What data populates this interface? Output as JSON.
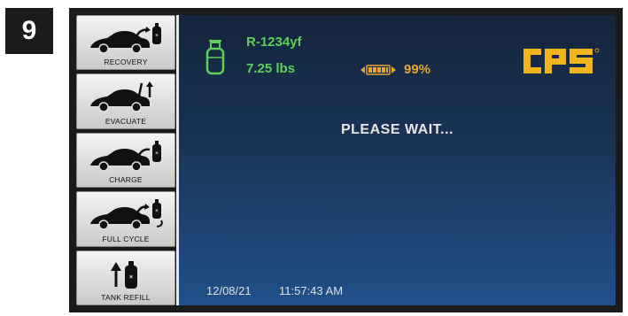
{
  "step": {
    "number": "9"
  },
  "sidebar": {
    "items": [
      {
        "label": "RECOVERY",
        "icon": "car-recovery-icon"
      },
      {
        "label": "EVACUATE",
        "icon": "car-evacuate-icon"
      },
      {
        "label": "CHARGE",
        "icon": "car-charge-icon"
      },
      {
        "label": "FULL CYCLE",
        "icon": "car-full-cycle-icon"
      },
      {
        "label": "TANK REFILL",
        "icon": "tank-refill-icon"
      }
    ]
  },
  "screen": {
    "refrigerant": "R-1234yf",
    "weight": "7.25 lbs",
    "battery_percent": "99%",
    "status": "PLEASE WAIT...",
    "date": "12/08/21",
    "time": "11:57:43 AM"
  },
  "logo": {
    "text": "CPS"
  },
  "colors": {
    "refrigerant_green": "#5fcf5a",
    "battery_orange": "#e8a530",
    "logo_yellow": "#f2b51c",
    "screen_top": "#14253b",
    "screen_bottom": "#21508a"
  }
}
